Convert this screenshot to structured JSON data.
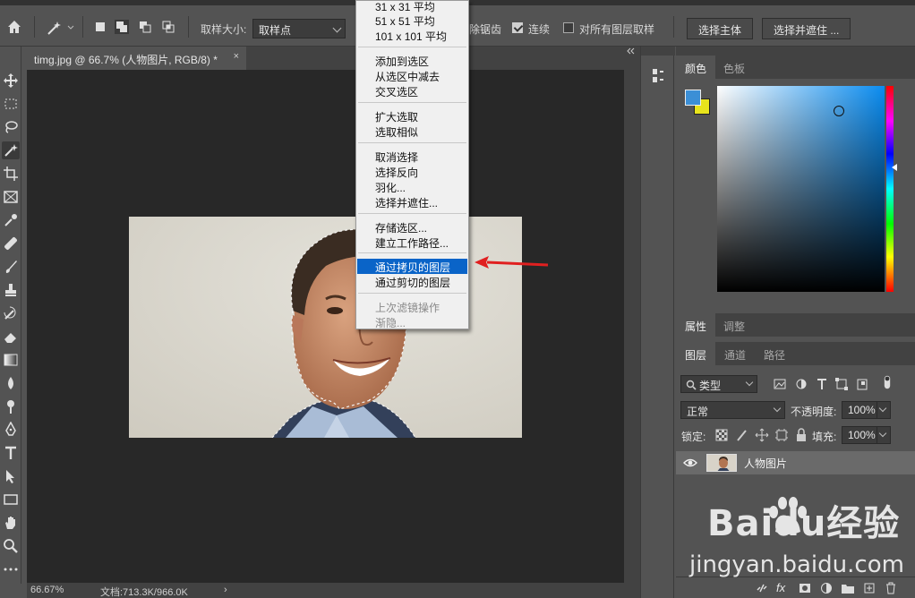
{
  "options_bar": {
    "sample_size_label": "取样大小:",
    "sample_size_value": "取样点",
    "antialias_label": "除锯齿",
    "contiguous_label": "连续",
    "sample_all_label": "对所有图层取样",
    "select_subject_button": "选择主体",
    "select_mask_button": "选择并遮住 ..."
  },
  "document": {
    "tab_title": "timg.jpg @ 66.7% (人物图片, RGB/8) *",
    "close": "×"
  },
  "status_bar": {
    "zoom": "66.67%",
    "doc_info": "文档:713.3K/966.0K",
    "arrow": "›"
  },
  "context_menu": {
    "items": [
      {
        "label": "31 x 31 平均",
        "state": "normal"
      },
      {
        "label": "51 x 51 平均",
        "state": "normal"
      },
      {
        "label": "101 x 101 平均",
        "state": "normal"
      },
      {
        "label": "添加到选区",
        "state": "normal"
      },
      {
        "label": "从选区中减去",
        "state": "normal"
      },
      {
        "label": "交叉选区",
        "state": "normal"
      },
      {
        "label": "扩大选取",
        "state": "normal"
      },
      {
        "label": "选取相似",
        "state": "normal"
      },
      {
        "label": "取消选择",
        "state": "normal"
      },
      {
        "label": "选择反向",
        "state": "normal"
      },
      {
        "label": "羽化...",
        "state": "normal"
      },
      {
        "label": "选择并遮住...",
        "state": "normal"
      },
      {
        "label": "存储选区...",
        "state": "normal"
      },
      {
        "label": "建立工作路径...",
        "state": "normal"
      },
      {
        "label": "通过拷贝的图层",
        "state": "highlighted"
      },
      {
        "label": "通过剪切的图层",
        "state": "normal"
      },
      {
        "label": "上次滤镜操作",
        "state": "disabled"
      },
      {
        "label": "渐隐...",
        "state": "disabled"
      }
    ]
  },
  "color_panel": {
    "tabs": [
      "颜色",
      "色板"
    ],
    "foreground": "#3b8fd6",
    "background": "#e8e41c",
    "picker_hue": "#0a8cf0"
  },
  "properties_panel": {
    "tabs": [
      "属性",
      "调整"
    ]
  },
  "layers_panel": {
    "tabs": [
      "图层",
      "通道",
      "路径"
    ],
    "filter_label": "类型",
    "blend_mode": "正常",
    "opacity_label": "不透明度:",
    "opacity_value": "100%",
    "lock_label": "锁定:",
    "fill_label": "填充:",
    "fill_value": "100%",
    "layers": [
      {
        "name": "人物图片",
        "visible": true
      }
    ],
    "footer_fx": "fx"
  },
  "watermark": {
    "logo": "Baidu经验",
    "url": "jingyan.baidu.com"
  },
  "colors": {
    "highlight": "#0a64c8",
    "arrow": "#e02020"
  }
}
